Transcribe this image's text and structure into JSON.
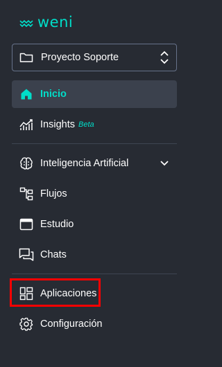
{
  "brand": {
    "name": "weni",
    "color": "#00dec9"
  },
  "project": {
    "name": "Proyecto Soporte",
    "icon": "folder-icon",
    "toggle_icon": "chevron-up-down-icon"
  },
  "nav": {
    "home": {
      "label": "Inicio",
      "icon": "home-icon",
      "active": true
    },
    "insights": {
      "label": "Insights",
      "badge": "Beta",
      "icon": "chart-icon"
    },
    "ai": {
      "label": "Inteligencia Artificial",
      "icon": "brain-icon",
      "expand_icon": "chevron-down-icon"
    },
    "flows": {
      "label": "Flujos",
      "icon": "flow-icon"
    },
    "studio": {
      "label": "Estudio",
      "icon": "window-icon"
    },
    "chats": {
      "label": "Chats",
      "icon": "chat-icon"
    },
    "apps": {
      "label": "Aplicaciones",
      "icon": "apps-icon",
      "highlighted": true
    },
    "settings": {
      "label": "Configuración",
      "icon": "gear-icon"
    }
  },
  "colors": {
    "background": "#272b33",
    "active_bg": "#3b414d",
    "accent": "#00dec9",
    "highlight": "#ff0000"
  }
}
